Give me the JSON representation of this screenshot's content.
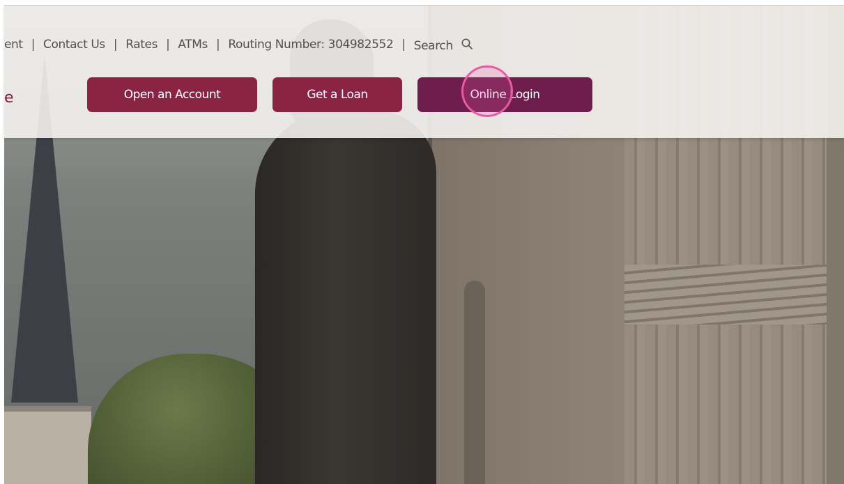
{
  "utility_nav": {
    "items": [
      {
        "label": "ent"
      },
      {
        "label": "Contact Us"
      },
      {
        "label": "Rates"
      },
      {
        "label": "ATMs"
      },
      {
        "label": "Routing Number: 304982552"
      },
      {
        "label": "Search"
      }
    ],
    "separator": "|",
    "search_icon": "search-icon"
  },
  "brand": {
    "fragment": "e"
  },
  "actions": {
    "open_account": "Open an Account",
    "get_loan": "Get a Loan",
    "online_login": "Online Login"
  },
  "colors": {
    "primary_button": "#8a2445",
    "login_button": "#6e1d4c",
    "click_indicator": "#e85aa8"
  }
}
